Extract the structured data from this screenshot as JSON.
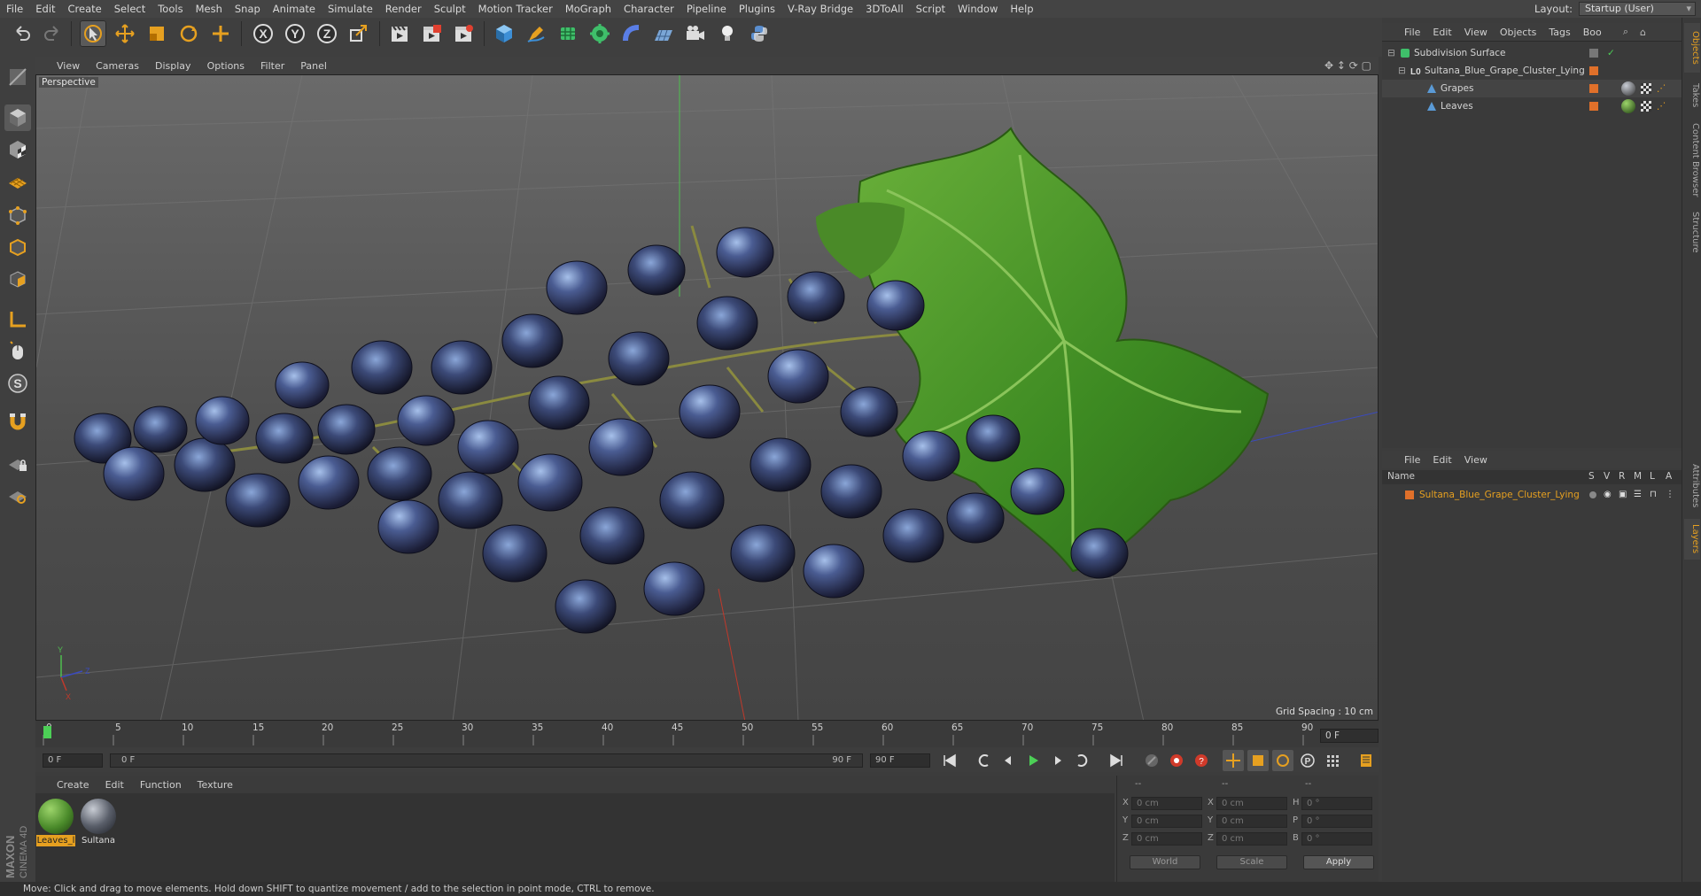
{
  "menu": [
    "File",
    "Edit",
    "Create",
    "Select",
    "Tools",
    "Mesh",
    "Snap",
    "Animate",
    "Simulate",
    "Render",
    "Sculpt",
    "Motion Tracker",
    "MoGraph",
    "Character",
    "Pipeline",
    "Plugins",
    "V-Ray Bridge",
    "3DToAll",
    "Script",
    "Window",
    "Help"
  ],
  "layout": {
    "label": "Layout:",
    "value": "Startup (User)"
  },
  "viewport": {
    "menu": [
      "View",
      "Cameras",
      "Display",
      "Options",
      "Filter",
      "Panel"
    ],
    "camera_label": "Perspective",
    "grid_spacing": "Grid Spacing : 10 cm"
  },
  "timeline": {
    "ticks": [
      "0",
      "5",
      "10",
      "15",
      "20",
      "25",
      "30",
      "35",
      "40",
      "45",
      "50",
      "55",
      "60",
      "65",
      "70",
      "75",
      "80",
      "85",
      "90"
    ],
    "current_frame": "0 F"
  },
  "transport": {
    "start_field": "0 F",
    "range_start": "0 F",
    "range_end": "90 F",
    "end_field": "90 F"
  },
  "materials": {
    "menu": [
      "Create",
      "Edit",
      "Function",
      "Texture"
    ],
    "items": [
      {
        "name": "Leaves_l",
        "color": "#4a8a2a",
        "selected": true
      },
      {
        "name": "Sultana",
        "color": "#3a3f48",
        "selected": false
      }
    ]
  },
  "coordinates": {
    "headers": [
      "--",
      "--",
      "--"
    ],
    "rows": [
      {
        "a": "X",
        "av": "0 cm",
        "b": "X",
        "bv": "0 cm",
        "c": "H",
        "cv": "0 °"
      },
      {
        "a": "Y",
        "av": "0 cm",
        "b": "Y",
        "bv": "0 cm",
        "c": "P",
        "cv": "0 °"
      },
      {
        "a": "Z",
        "av": "0 cm",
        "b": "Z",
        "bv": "0 cm",
        "c": "B",
        "cv": "0 °"
      }
    ],
    "mode": "World",
    "scale": "Scale",
    "apply": "Apply"
  },
  "objects": {
    "menu": [
      "File",
      "Edit",
      "View",
      "Objects",
      "Tags",
      "Boo"
    ],
    "tree": [
      {
        "name": "Subdivision Surface",
        "level": 0
      },
      {
        "name": "Sultana_Blue_Grape_Cluster_Lying",
        "level": 1
      },
      {
        "name": "Grapes",
        "level": 2
      },
      {
        "name": "Leaves",
        "level": 2
      }
    ]
  },
  "layers": {
    "menu": [
      "File",
      "Edit",
      "View"
    ],
    "columns": [
      "Name",
      "S",
      "V",
      "R",
      "M",
      "L",
      "A"
    ],
    "items": [
      {
        "name": "Sultana_Blue_Grape_Cluster_Lying",
        "color": "#e6a020"
      }
    ]
  },
  "side_tabs": [
    "Objects",
    "Takes",
    "Content Browser",
    "Structure",
    "Attributes",
    "Layers"
  ],
  "brand": {
    "maxon": "MAXON",
    "product": "CINEMA 4D"
  },
  "status": "Move: Click and drag to move elements. Hold down SHIFT to quantize movement / add to the selection in point mode, CTRL to remove."
}
